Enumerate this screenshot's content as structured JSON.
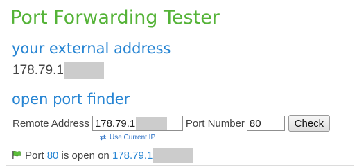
{
  "page": {
    "title": "Port Forwarding Tester",
    "external_heading": "your external address",
    "external_ip": "178.79.1",
    "finder_heading": "open port finder"
  },
  "form": {
    "remote_label": "Remote Address",
    "remote_value": "178.79.1",
    "port_label": "Port Number",
    "port_value": "80",
    "check_label": "Check",
    "use_current_ip_label": "Use Current IP"
  },
  "result": {
    "prefix": "Port",
    "port": "80",
    "middle": "is open on",
    "address": "178.79.1"
  },
  "icons": {
    "use_ip": "swap-arrows-icon",
    "status": "green-flag-icon"
  },
  "colors": {
    "title": "#55b338",
    "heading": "#2785d3",
    "link": "#2a6fc4",
    "redaction": "#cccccc"
  }
}
